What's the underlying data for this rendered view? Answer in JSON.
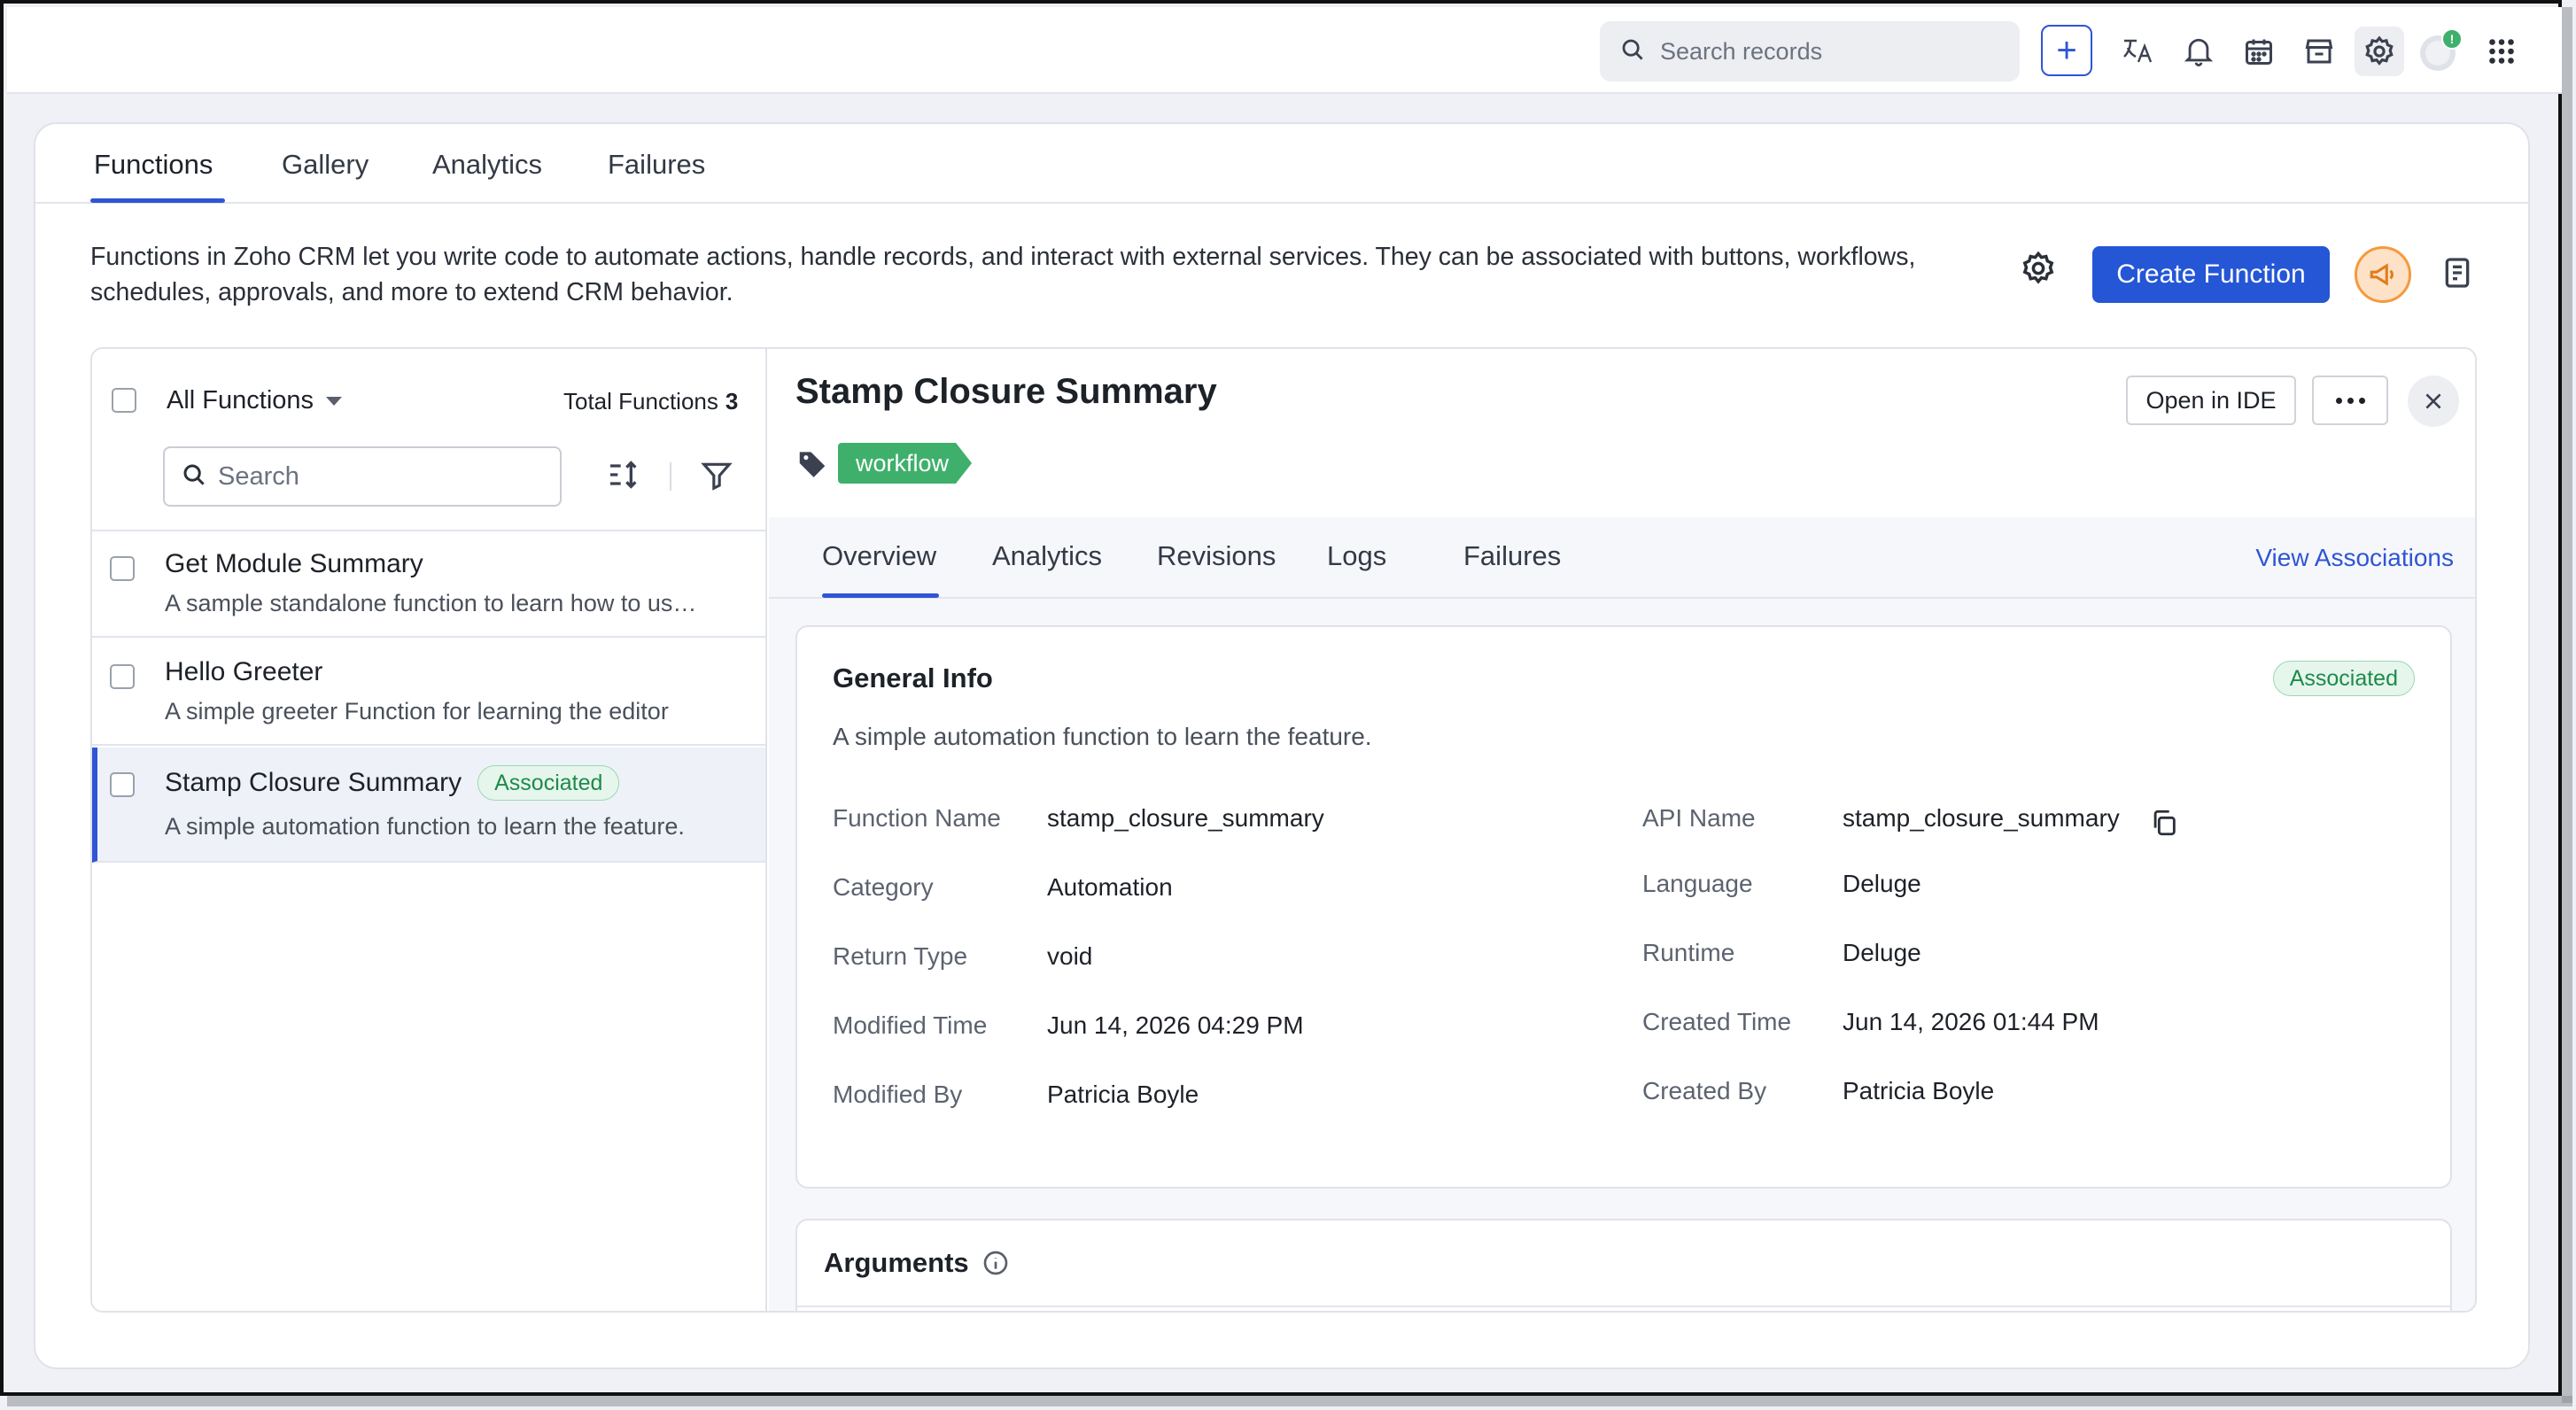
{
  "topbar": {
    "search_placeholder": "Search records",
    "notification_badge": "!"
  },
  "main_tabs": [
    {
      "label": "Functions",
      "active": true
    },
    {
      "label": "Gallery",
      "active": false
    },
    {
      "label": "Analytics",
      "active": false
    },
    {
      "label": "Failures",
      "active": false
    }
  ],
  "description": "Functions in Zoho CRM let you write code to automate actions, handle records, and interact with external services. They can be associated with buttons, workflows, schedules, approvals, and more to extend CRM behavior.",
  "create_button": "Create Function",
  "list": {
    "filter_label": "All Functions",
    "total_label": "Total Functions",
    "total_count": "3",
    "search_placeholder": "Search",
    "items": [
      {
        "title": "Get Module Summary",
        "subtitle": "A sample standalone function to learn how to use functions",
        "badge": ""
      },
      {
        "title": "Hello Greeter",
        "subtitle": "A simple greeter Function for learning the editor",
        "badge": ""
      },
      {
        "title": "Stamp Closure Summary",
        "subtitle": "A simple automation function to learn the feature.",
        "badge": "Associated",
        "selected": true
      }
    ]
  },
  "detail": {
    "title": "Stamp Closure Summary",
    "tag": "workflow",
    "open_ide": "Open in IDE",
    "tabs": [
      {
        "label": "Overview",
        "active": true
      },
      {
        "label": "Analytics",
        "active": false
      },
      {
        "label": "Revisions",
        "active": false
      },
      {
        "label": "Logs",
        "active": false
      },
      {
        "label": "Failures",
        "active": false
      }
    ],
    "view_associations": "View Associations",
    "general_info": {
      "heading": "General Info",
      "status": "Associated",
      "description": "A simple automation function to learn the feature.",
      "left_fields": [
        {
          "label": "Function Name",
          "value": "stamp_closure_summary"
        },
        {
          "label": "Category",
          "value": "Automation"
        },
        {
          "label": "Return Type",
          "value": "void"
        },
        {
          "label": "Modified Time",
          "value": "Jun 14, 2026 04:29 PM"
        },
        {
          "label": "Modified By",
          "value": "Patricia Boyle"
        }
      ],
      "right_fields": [
        {
          "label": "API Name",
          "value": "stamp_closure_summary"
        },
        {
          "label": "Language",
          "value": "Deluge"
        },
        {
          "label": "Runtime",
          "value": "Deluge"
        },
        {
          "label": "Created Time",
          "value": "Jun 14, 2026 01:44 PM"
        },
        {
          "label": "Created By",
          "value": "Patricia Boyle"
        }
      ]
    },
    "arguments_heading": "Arguments"
  },
  "colors": {
    "primary": "#2456d6",
    "success": "#3fb06b",
    "accent_orange": "#f59a3c"
  }
}
